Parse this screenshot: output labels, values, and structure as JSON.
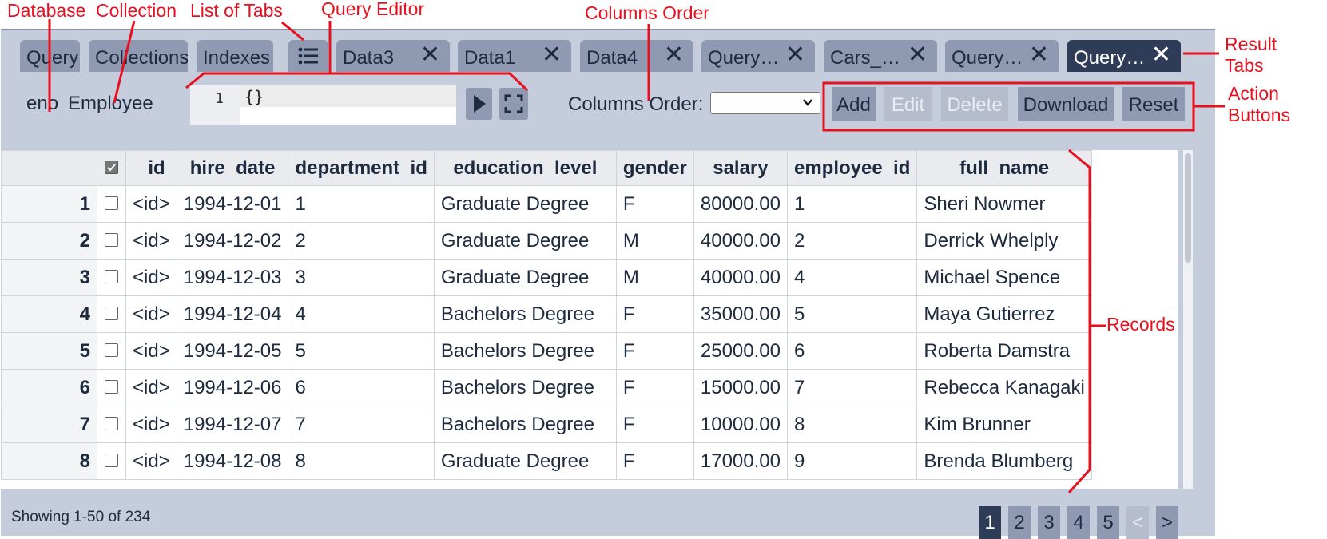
{
  "annotations": {
    "database": "Database",
    "collection": "Collection",
    "list_of_tabs": "List of Tabs",
    "query_editor": "Query Editor",
    "columns_order": "Columns Order",
    "result_tabs_1": "Result",
    "result_tabs_2": "Tabs",
    "action_buttons_1": "Action",
    "action_buttons_2": "Buttons",
    "records": "Records"
  },
  "tabs": {
    "query": "Query",
    "collections": "Collections",
    "indexes": "Indexes",
    "list_icon": "list-icon",
    "results": [
      {
        "label": "Data3",
        "close": "✕"
      },
      {
        "label": "Data1",
        "close": "✕"
      },
      {
        "label": "Data4",
        "close": "✕"
      },
      {
        "label": "Query…",
        "close": "✕"
      },
      {
        "label": "Cars_…",
        "close": "✕"
      },
      {
        "label": "Query…",
        "close": "✕"
      },
      {
        "label": "Query…",
        "close": "✕"
      }
    ]
  },
  "toolbar": {
    "database": "eno",
    "collection": "Employee",
    "editor": {
      "line_number": "1",
      "code": "{}"
    },
    "run_icon": "play-icon",
    "fullscreen_icon": "fullscreen-icon",
    "columns_order_label": "Columns Order:",
    "columns_order_value": "",
    "buttons": {
      "add": "Add",
      "edit": "Edit",
      "delete": "Delete",
      "download": "Download",
      "reset": "Reset"
    }
  },
  "table": {
    "columns": [
      "_id",
      "hire_date",
      "department_id",
      "education_level",
      "gender",
      "salary",
      "employee_id",
      "full_name"
    ],
    "rows": [
      {
        "n": "1",
        "id": "<id>",
        "hire_date": "1994-12-01",
        "department_id": "1",
        "education_level": "Graduate Degree",
        "gender": "F",
        "salary": "80000.00",
        "employee_id": "1",
        "full_name": "Sheri Nowmer"
      },
      {
        "n": "2",
        "id": "<id>",
        "hire_date": "1994-12-02",
        "department_id": "2",
        "education_level": "Graduate Degree",
        "gender": "M",
        "salary": "40000.00",
        "employee_id": "2",
        "full_name": "Derrick Whelply"
      },
      {
        "n": "3",
        "id": "<id>",
        "hire_date": "1994-12-03",
        "department_id": "3",
        "education_level": "Graduate Degree",
        "gender": "M",
        "salary": "40000.00",
        "employee_id": "4",
        "full_name": "Michael Spence"
      },
      {
        "n": "4",
        "id": "<id>",
        "hire_date": "1994-12-04",
        "department_id": "4",
        "education_level": "Bachelors Degree",
        "gender": "F",
        "salary": "35000.00",
        "employee_id": "5",
        "full_name": "Maya Gutierrez"
      },
      {
        "n": "5",
        "id": "<id>",
        "hire_date": "1994-12-05",
        "department_id": "5",
        "education_level": "Bachelors Degree",
        "gender": "F",
        "salary": "25000.00",
        "employee_id": "6",
        "full_name": "Roberta Damstra"
      },
      {
        "n": "6",
        "id": "<id>",
        "hire_date": "1994-12-06",
        "department_id": "6",
        "education_level": "Bachelors Degree",
        "gender": "F",
        "salary": "15000.00",
        "employee_id": "7",
        "full_name": "Rebecca Kanagaki"
      },
      {
        "n": "7",
        "id": "<id>",
        "hire_date": "1994-12-07",
        "department_id": "7",
        "education_level": "Bachelors Degree",
        "gender": "F",
        "salary": "10000.00",
        "employee_id": "8",
        "full_name": "Kim Brunner"
      },
      {
        "n": "8",
        "id": "<id>",
        "hire_date": "1994-12-08",
        "department_id": "8",
        "education_level": "Graduate Degree",
        "gender": "F",
        "salary": "17000.00",
        "employee_id": "9",
        "full_name": "Brenda Blumberg"
      }
    ]
  },
  "footer": {
    "showing": "Showing 1-50 of 234",
    "pages": [
      "1",
      "2",
      "3",
      "4",
      "5"
    ],
    "prev": "<",
    "next": ">"
  },
  "colors": {
    "annotation": "#e8101e",
    "tab": "#8f9ab2",
    "tab_active": "#2f3c57",
    "panel": "#c5ccdb"
  }
}
